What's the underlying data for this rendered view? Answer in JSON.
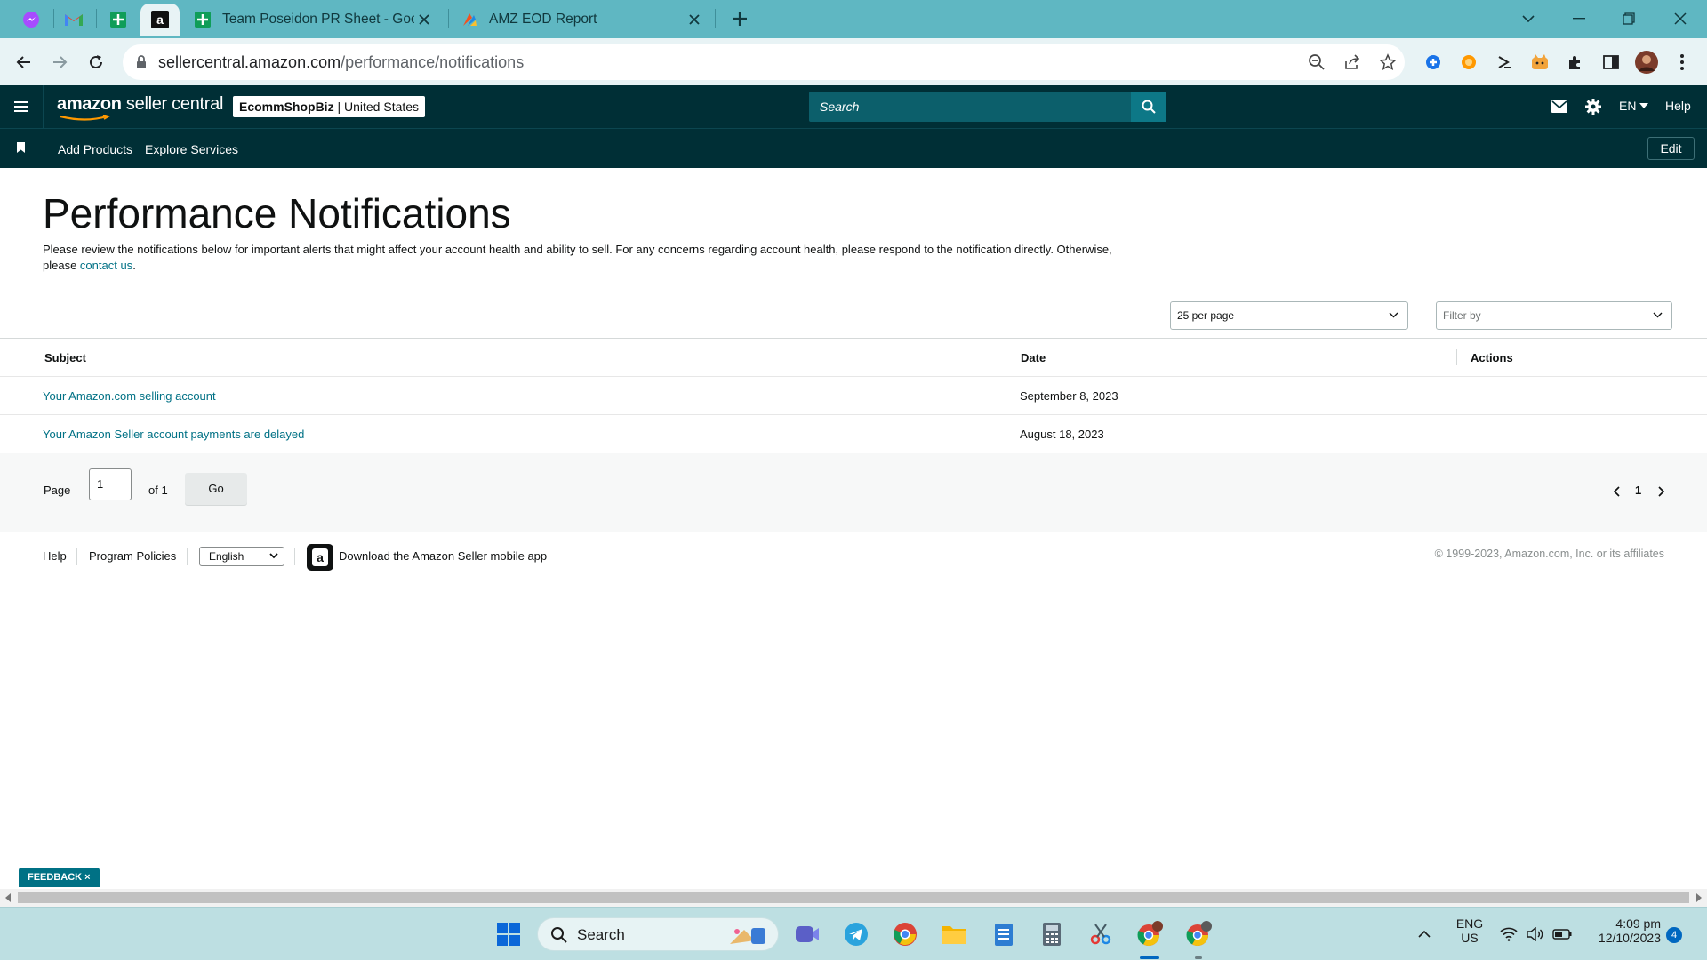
{
  "browser": {
    "tabs": [
      {
        "title": "Team Poseidon PR Sheet - Goog"
      },
      {
        "title": "AMZ EOD Report"
      }
    ],
    "url_host": "sellercentral.amazon.com",
    "url_path": "/performance/notifications"
  },
  "header": {
    "logo_bold": "amazon",
    "logo_rest": " seller central",
    "store_name": "EcommShopBiz",
    "marketplace": " | United States",
    "search_placeholder": "Search",
    "language": "EN",
    "help": "Help"
  },
  "subnav": {
    "links": [
      "Add Products",
      "Explore Services"
    ],
    "edit": "Edit"
  },
  "main": {
    "title": "Performance Notifications",
    "intro": "Please review the notifications below for important alerts that might affect your account health and ability to sell. For any concerns regarding account health, please respond to the notification directly. Otherwise, please ",
    "intro_link": "contact us",
    "intro_end": ".",
    "per_page": "25 per page",
    "filter_placeholder": "Filter by",
    "columns": {
      "subject": "Subject",
      "date": "Date",
      "actions": "Actions"
    },
    "rows": [
      {
        "subject": "Your Amazon.com selling account",
        "date": "September 8, 2023"
      },
      {
        "subject": "Your Amazon Seller account payments are delayed",
        "date": "August 18, 2023"
      }
    ],
    "pager": {
      "page_label": "Page",
      "page_value": "1",
      "of_label": "of 1",
      "go": "Go",
      "current": "1"
    }
  },
  "footer": {
    "help": "Help",
    "program_policies": "Program Policies",
    "language": "English",
    "app_text": "Download the Amazon Seller mobile app",
    "copyright": "© 1999-2023, Amazon.com, Inc. or its affiliates"
  },
  "feedback": "FEEDBACK ×",
  "taskbar": {
    "search": "Search",
    "lang_top": "ENG",
    "lang_bottom": "US",
    "time": "4:09 pm",
    "date": "12/10/2023",
    "notification_count": "4"
  },
  "colors": {
    "header_bg": "#002f36",
    "link": "#007185",
    "tabstrip": "#5fb7c2"
  }
}
